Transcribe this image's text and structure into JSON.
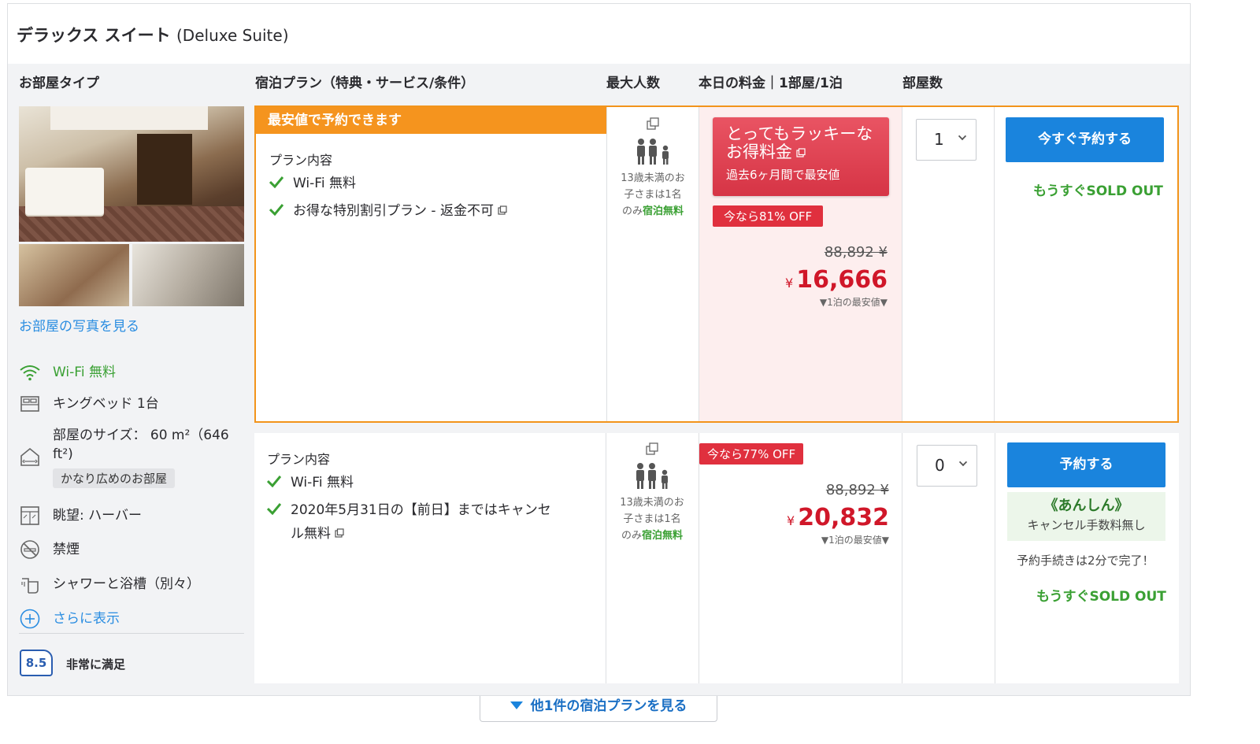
{
  "room": {
    "title_ja": "デラックス スイート",
    "title_en": "(Deluxe Suite)"
  },
  "columns": {
    "room_type": "お部屋タイプ",
    "plan": "宿泊プラン（特典・サービス/条件）",
    "max_guests": "最大人数",
    "price": "本日の料金｜1部屋/1泊",
    "rooms": "部屋数"
  },
  "room_info": {
    "photos_link": "お部屋の写真を見る",
    "amenities": [
      {
        "label": "Wi-Fi 無料",
        "icon": "wifi-icon"
      },
      {
        "label": "キングベッド 1台",
        "icon": "bed-icon"
      },
      {
        "label": "部屋のサイズ： 60 m²（646",
        "icon": "room-size-icon"
      },
      {
        "label": "ft²)",
        "icon": ""
      },
      {
        "label": "眺望: ハーバー",
        "icon": "view-icon"
      },
      {
        "label": "禁煙",
        "icon": "no-smoking-icon"
      },
      {
        "label": "シャワーと浴槽（別々）",
        "icon": "shower-icon"
      }
    ],
    "size_tag": "かなり広めのお部屋",
    "show_more": "さらに表示",
    "score": "8.5",
    "score_label": "非常に満足"
  },
  "plans": [
    {
      "banner": "最安値で予約できます",
      "content_label": "プラン内容",
      "items": [
        "Wi-Fi 無料",
        "お得な特別割引プラン - 返金不可"
      ],
      "occupancy_note": [
        "13歳未満のお",
        "子さまは1名",
        "のみ"
      ],
      "occupancy_free": "宿泊無料",
      "lucky_title": [
        "とってもラッキーな",
        "お得料金"
      ],
      "lucky_sub": "過去6ヶ月間で最安値",
      "discount": "今なら81% OFF",
      "old_price": "88,892 ¥",
      "currency": "¥",
      "price": "16,666",
      "min_note": "▼1泊の最安値▼",
      "rooms_selected": "1",
      "book_label": "今すぐ予約する",
      "soldout": "もうすぐSOLD OUT"
    },
    {
      "content_label": "プラン内容",
      "items": [
        "Wi-Fi 無料",
        "2020年5月31日の【前日】まではキャンセ",
        "ル無料"
      ],
      "occupancy_note": [
        "13歳未満のお",
        "子さまは1名",
        "のみ"
      ],
      "occupancy_free": "宿泊無料",
      "discount": "今なら77% OFF",
      "old_price": "88,892 ¥",
      "currency": "¥",
      "price": "20,832",
      "min_note": "▼1泊の最安値▼",
      "rooms_selected": "0",
      "book_label": "予約する",
      "anshin_title": "《あんしん》",
      "anshin_sub": "キャンセル手数料無し",
      "quick": "予約手続きは2分で完了！",
      "soldout": "もうすぐSOLD OUT"
    }
  ],
  "more_plans": "他1件の宿泊プランを見る",
  "colors": {
    "accent_orange": "#f5941e",
    "button_blue": "#1a84dd",
    "price_red": "#d01729",
    "green": "#3aa033"
  }
}
